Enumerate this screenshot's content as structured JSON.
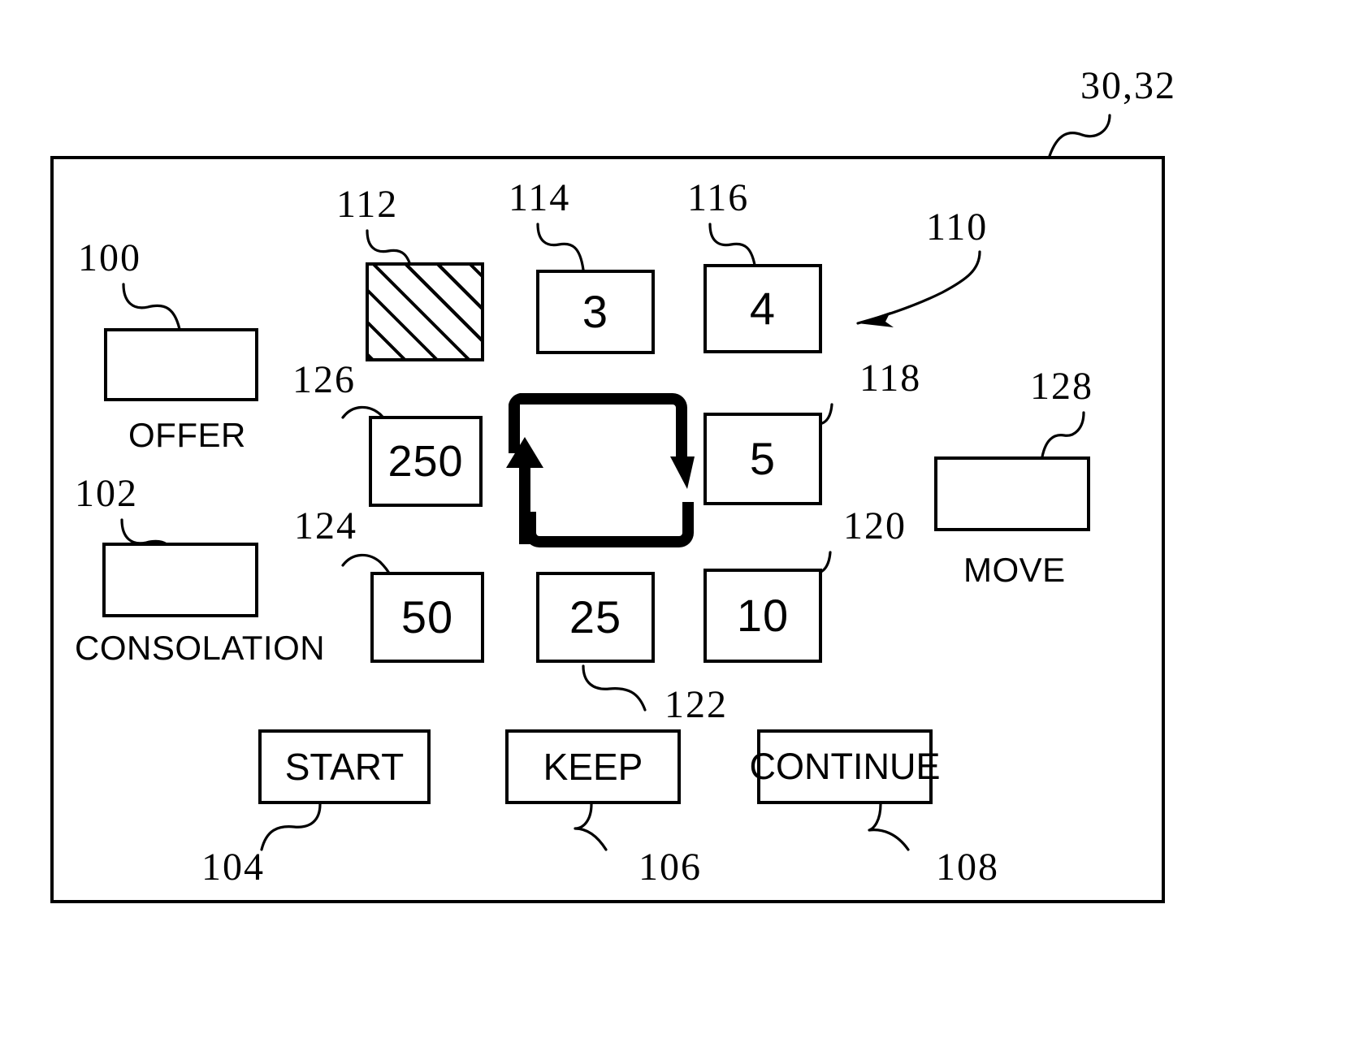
{
  "figure": {
    "device_ref": "30,32",
    "panel_ref": "110"
  },
  "panel": {
    "offer": {
      "ref": "100",
      "label": "OFFER"
    },
    "consolation": {
      "ref": "102",
      "label": "CONSOLATION"
    },
    "move": {
      "ref": "128",
      "label": "MOVE"
    }
  },
  "award_cells": [
    {
      "ref": "112",
      "value": "",
      "fill": "hatched"
    },
    {
      "ref": "114",
      "value": "3",
      "fill": "none"
    },
    {
      "ref": "116",
      "value": "4",
      "fill": "none"
    },
    {
      "ref": "126",
      "value": "250",
      "fill": "none"
    },
    {
      "ref": "118",
      "value": "5",
      "fill": "none"
    },
    {
      "ref": "124",
      "value": "50",
      "fill": "none"
    },
    {
      "ref": "122",
      "value": "25",
      "fill": "none"
    },
    {
      "ref": "120",
      "value": "10",
      "fill": "none"
    }
  ],
  "buttons": [
    {
      "ref": "104",
      "label": "START"
    },
    {
      "ref": "106",
      "label": "KEEP"
    },
    {
      "ref": "108",
      "label": "CONTINUE"
    }
  ],
  "cycle_indicator": {
    "name": "rotation-loop",
    "direction": "clockwise",
    "arrows": [
      "up-arrow-left-side",
      "down-arrow-right-side"
    ]
  }
}
